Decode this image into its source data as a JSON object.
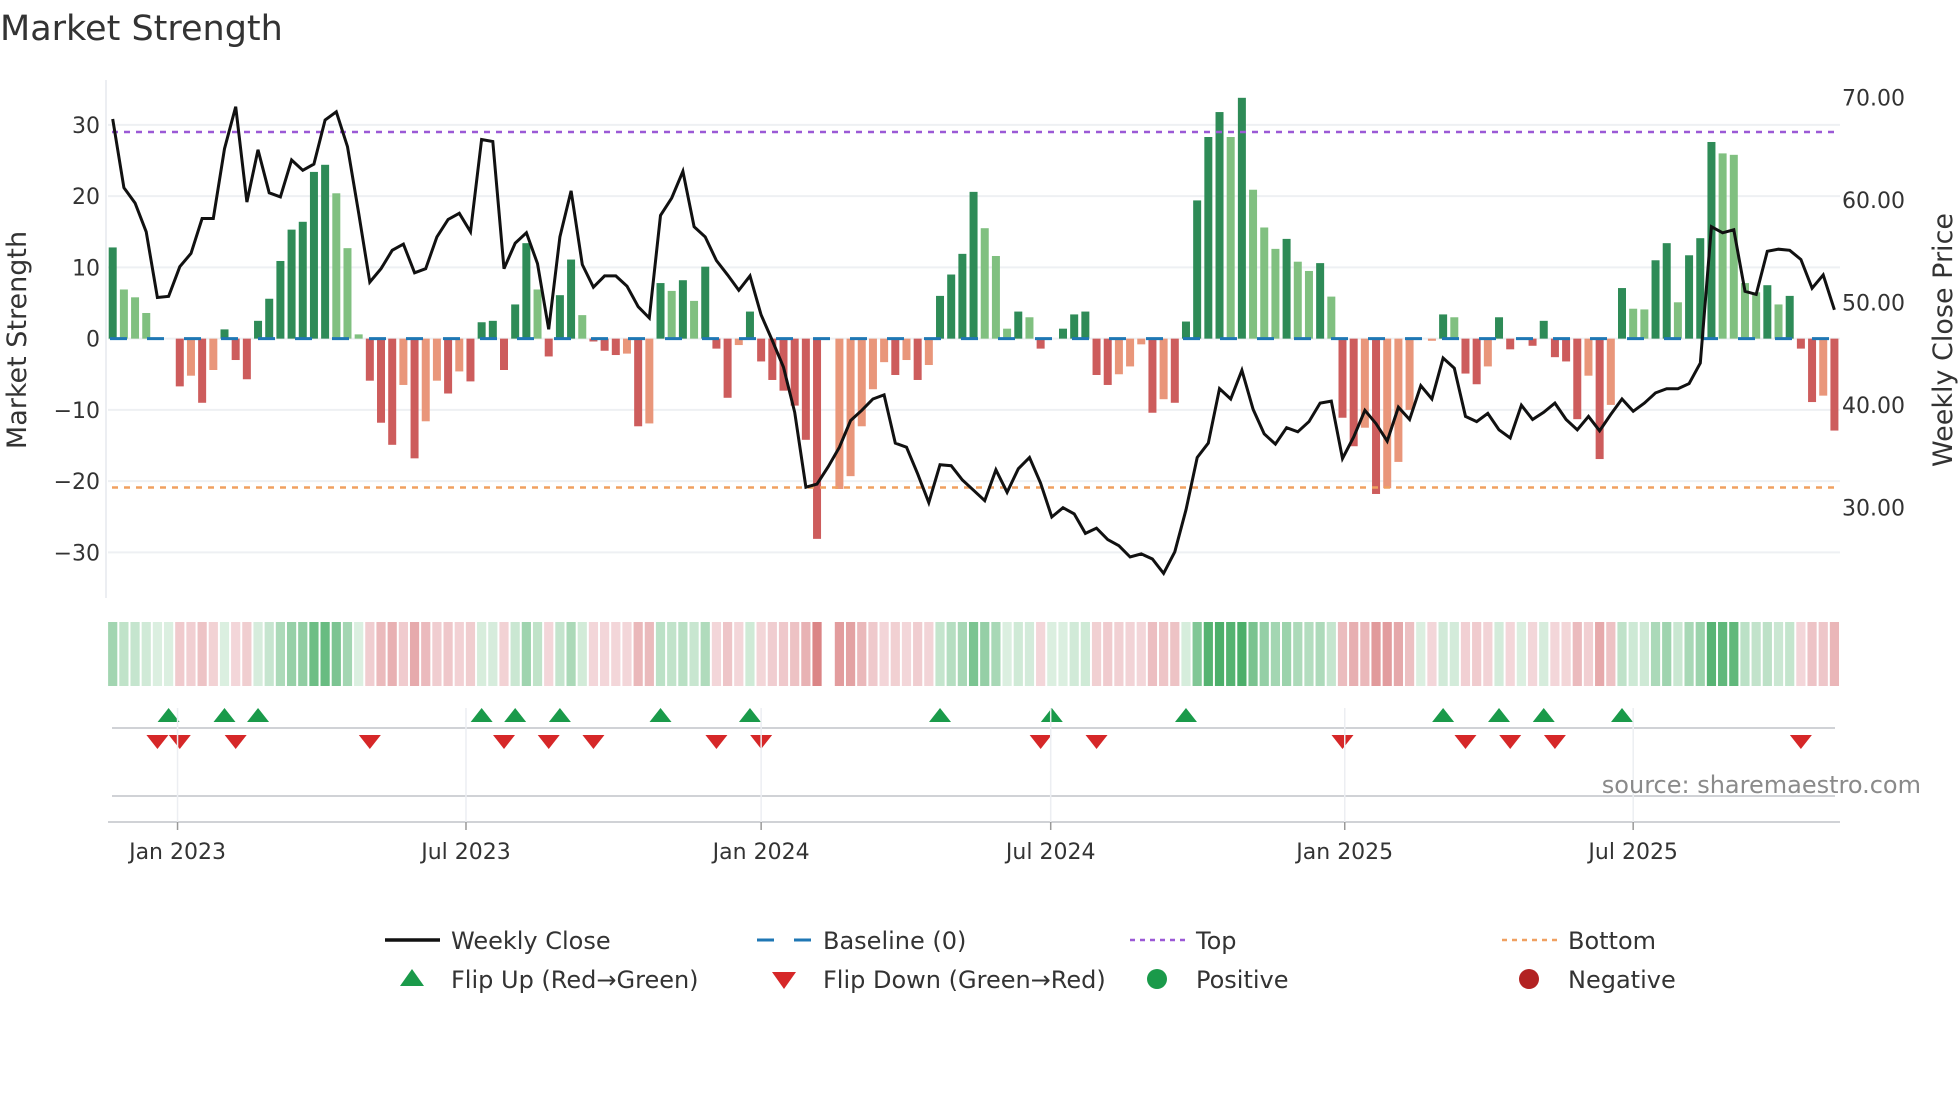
{
  "chart_data": {
    "type": "bar",
    "title": "Market Strength",
    "ylabel": "Market Strength",
    "y2label": "Weekly Close Price",
    "source": "source: sharemaestro.com",
    "x": "week index (weekly, Dec 2022 – Oct 2025)",
    "ylim": [
      -36.4,
      36.3
    ],
    "y2lim": [
      21.2,
      71.7
    ],
    "left_ticks": [
      "−30",
      "−20",
      "−10",
      "0",
      "10",
      "20",
      "30"
    ],
    "left_tick_values": [
      -30,
      -20,
      -10,
      0,
      10,
      20,
      30
    ],
    "right_ticks": [
      "30.00",
      "40.00",
      "50.00",
      "60.00",
      "70.00"
    ],
    "right_tick_values": [
      30,
      40,
      50,
      60,
      70
    ],
    "x_ticks": [
      {
        "label": "Jan 2023",
        "week": 6.8
      },
      {
        "label": "Jul 2023",
        "week": 32.6
      },
      {
        "label": "Jan 2024",
        "week": 59.0
      },
      {
        "label": "Jul 2024",
        "week": 84.9
      },
      {
        "label": "Jan 2025",
        "week": 111.2
      },
      {
        "label": "Jul 2025",
        "week": 137.0
      }
    ],
    "top_level": 29.0,
    "bottom_level": -20.9,
    "baseline": 0,
    "grid": true,
    "legend_position": "bottom",
    "colors": {
      "strong_green": "#2e8b57",
      "weak_green": "#80c080",
      "strong_red": "#cd5c5c",
      "weak_red": "#e9967a",
      "close_line": "#111111",
      "baseline": "#1f77b4",
      "top": "#9b59d6",
      "bottom": "#f0a060",
      "flip_up": "#1a9a4a",
      "flip_down": "#d62728",
      "positive": "#1a9a4a",
      "negative": "#b22222"
    },
    "strength": [
      12.8,
      6.9,
      5.8,
      3.6,
      0,
      0,
      -6.7,
      -5.2,
      -9.0,
      -4.4,
      1.3,
      -3.0,
      -5.7,
      2.5,
      5.6,
      10.9,
      15.3,
      16.4,
      23.4,
      24.4,
      20.4,
      12.7,
      0.6,
      -5.9,
      -11.8,
      -14.9,
      -6.5,
      -16.8,
      -11.6,
      -5.9,
      -7.7,
      -4.6,
      -6.0,
      2.3,
      2.5,
      -4.4,
      4.8,
      13.4,
      6.9,
      -2.5,
      6.1,
      11.1,
      3.3,
      -0.4,
      -1.7,
      -2.3,
      -2.1,
      -12.3,
      -11.9,
      7.8,
      6.7,
      8.2,
      5.3,
      10.1,
      -1.4,
      -8.3,
      -0.9,
      3.8,
      -3.2,
      -5.8,
      -7.3,
      -9.4,
      -14.2,
      -28.1,
      0,
      -21.1,
      -19.3,
      -12.3,
      -7.1,
      -3.3,
      -5.1,
      -3.0,
      -5.8,
      -3.7,
      6.0,
      9.0,
      11.9,
      20.6,
      15.5,
      11.6,
      1.4,
      3.8,
      3.0,
      -1.4,
      0,
      1.4,
      3.4,
      3.8,
      -5.1,
      -6.5,
      -5.0,
      -3.9,
      -0.8,
      -10.4,
      -8.5,
      -9.0,
      2.4,
      19.4,
      28.3,
      31.8,
      28.3,
      33.8,
      20.9,
      15.6,
      12.6,
      14.0,
      10.8,
      9.5,
      10.6,
      5.9,
      -11.1,
      -15.1,
      -12.5,
      -21.8,
      -21.0,
      -17.3,
      -10.0,
      0,
      -0.3,
      3.4,
      3.0,
      -4.9,
      -6.4,
      -3.9,
      3.0,
      -1.5,
      0,
      -1.0,
      2.5,
      -2.6,
      -3.2,
      -11.3,
      -5.2,
      -16.9,
      -9.3,
      7.1,
      4.2,
      4.1,
      11.0,
      13.4,
      5.1,
      11.7,
      14.1,
      27.6,
      26.0,
      25.8,
      7.8,
      6.5,
      7.5,
      4.8,
      6.0,
      -1.4,
      -8.9,
      -8.0,
      -12.9
    ],
    "shade": "DLLL00RSRSDRRDDDDDDDLLLRRRSRSSRSRDDRDDLRDDLRRRSRSDLDLDRRSDRRRRRR0SSSSSRSRSDDDDLLLDLR0DDDRRSSSRSRDDDDLDLLLDLLDLRRSRSSS0SDLRRSDR0RDRRRSRSDLLDDLDDDLLLLDLDRRSR",
    "weekly_close": [
      67.9,
      61.2,
      59.7,
      56.9,
      50.5,
      50.6,
      53.5,
      54.8,
      58.2,
      58.2,
      65.0,
      69.1,
      59.8,
      64.9,
      60.7,
      60.3,
      63.9,
      62.9,
      63.5,
      67.8,
      68.6,
      65.2,
      58.7,
      52.0,
      53.3,
      55.1,
      55.7,
      52.9,
      53.3,
      56.4,
      58.1,
      58.7,
      56.9,
      65.9,
      65.7,
      53.3,
      55.8,
      56.8,
      53.8,
      47.4,
      56.4,
      60.9,
      53.7,
      51.5,
      52.6,
      52.6,
      51.6,
      49.6,
      48.5,
      58.5,
      60.2,
      62.8,
      57.4,
      56.4,
      54.1,
      52.7,
      51.2,
      52.6,
      48.8,
      46.3,
      43.7,
      39.3,
      32.0,
      32.3,
      34.0,
      35.9,
      38.5,
      39.5,
      40.6,
      41.0,
      36.3,
      35.9,
      33.3,
      30.5,
      34.2,
      34.1,
      32.7,
      31.7,
      30.7,
      33.7,
      31.5,
      33.8,
      34.9,
      32.4,
      29.1,
      30.0,
      29.4,
      27.5,
      28.0,
      26.9,
      26.3,
      25.2,
      25.5,
      25.0,
      23.6,
      25.7,
      29.8,
      34.9,
      36.3,
      41.6,
      40.6,
      43.4,
      39.6,
      37.2,
      36.2,
      37.8,
      37.4,
      38.4,
      40.2,
      40.4,
      34.8,
      36.9,
      39.5,
      38.2,
      36.5,
      39.8,
      38.6,
      41.9,
      40.6,
      44.6,
      43.6,
      38.9,
      38.4,
      39.2,
      37.6,
      36.8,
      40.0,
      38.6,
      39.3,
      40.2,
      38.6,
      37.6,
      38.9,
      37.5,
      39.1,
      40.6,
      39.4,
      40.2,
      41.2,
      41.6,
      41.6,
      42.1,
      44.1,
      57.4,
      56.8,
      57.1,
      51.1,
      50.8,
      55.0,
      55.2,
      55.1,
      54.2,
      51.4,
      52.7,
      49.3
    ],
    "flip_up_weeks": [
      6,
      11,
      14,
      34,
      37,
      41,
      50,
      58,
      75,
      85,
      97,
      120,
      125,
      129,
      136
    ],
    "flip_down_weeks": [
      5,
      7,
      12,
      24,
      36,
      40,
      44,
      55,
      59,
      84,
      89,
      111,
      122,
      126,
      130,
      152
    ],
    "legend": [
      {
        "key": "weekly-close",
        "label": "Weekly Close"
      },
      {
        "key": "baseline",
        "label": "Baseline (0)"
      },
      {
        "key": "top",
        "label": "Top"
      },
      {
        "key": "bottom",
        "label": "Bottom"
      },
      {
        "key": "flip-up",
        "label": "Flip Up (Red→Green)"
      },
      {
        "key": "flip-down",
        "label": "Flip Down (Green→Red)"
      },
      {
        "key": "positive",
        "label": "Positive"
      },
      {
        "key": "negative",
        "label": "Negative"
      }
    ]
  }
}
